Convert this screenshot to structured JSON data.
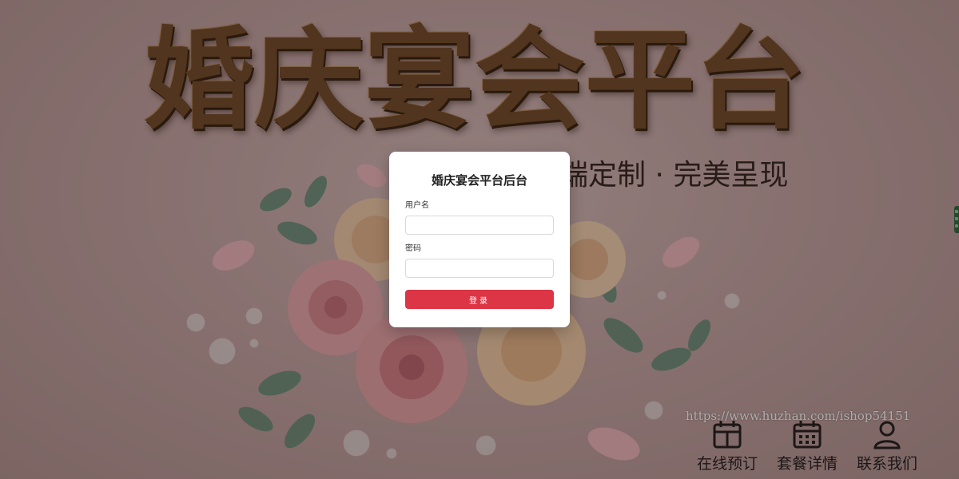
{
  "background": {
    "headline": "婚庆宴会平台",
    "slogan": "高端定制 · 完美呈现",
    "watermark": "https://www.huzhan.com/ishop54151",
    "quick_links": [
      {
        "label": "在线预订",
        "icon": "calendar-icon"
      },
      {
        "label": "套餐详情",
        "icon": "calendar-grid-icon"
      },
      {
        "label": "联系我们",
        "icon": "user-icon"
      }
    ]
  },
  "login": {
    "title": "婚庆宴会平台后台",
    "username_label": "用户名",
    "username_value": "",
    "password_label": "密码",
    "password_value": "",
    "submit_label": "登录"
  },
  "colors": {
    "primary_button": "#dc3545",
    "card_background": "#ffffff",
    "headline_bronze": "#7a4f2d"
  }
}
